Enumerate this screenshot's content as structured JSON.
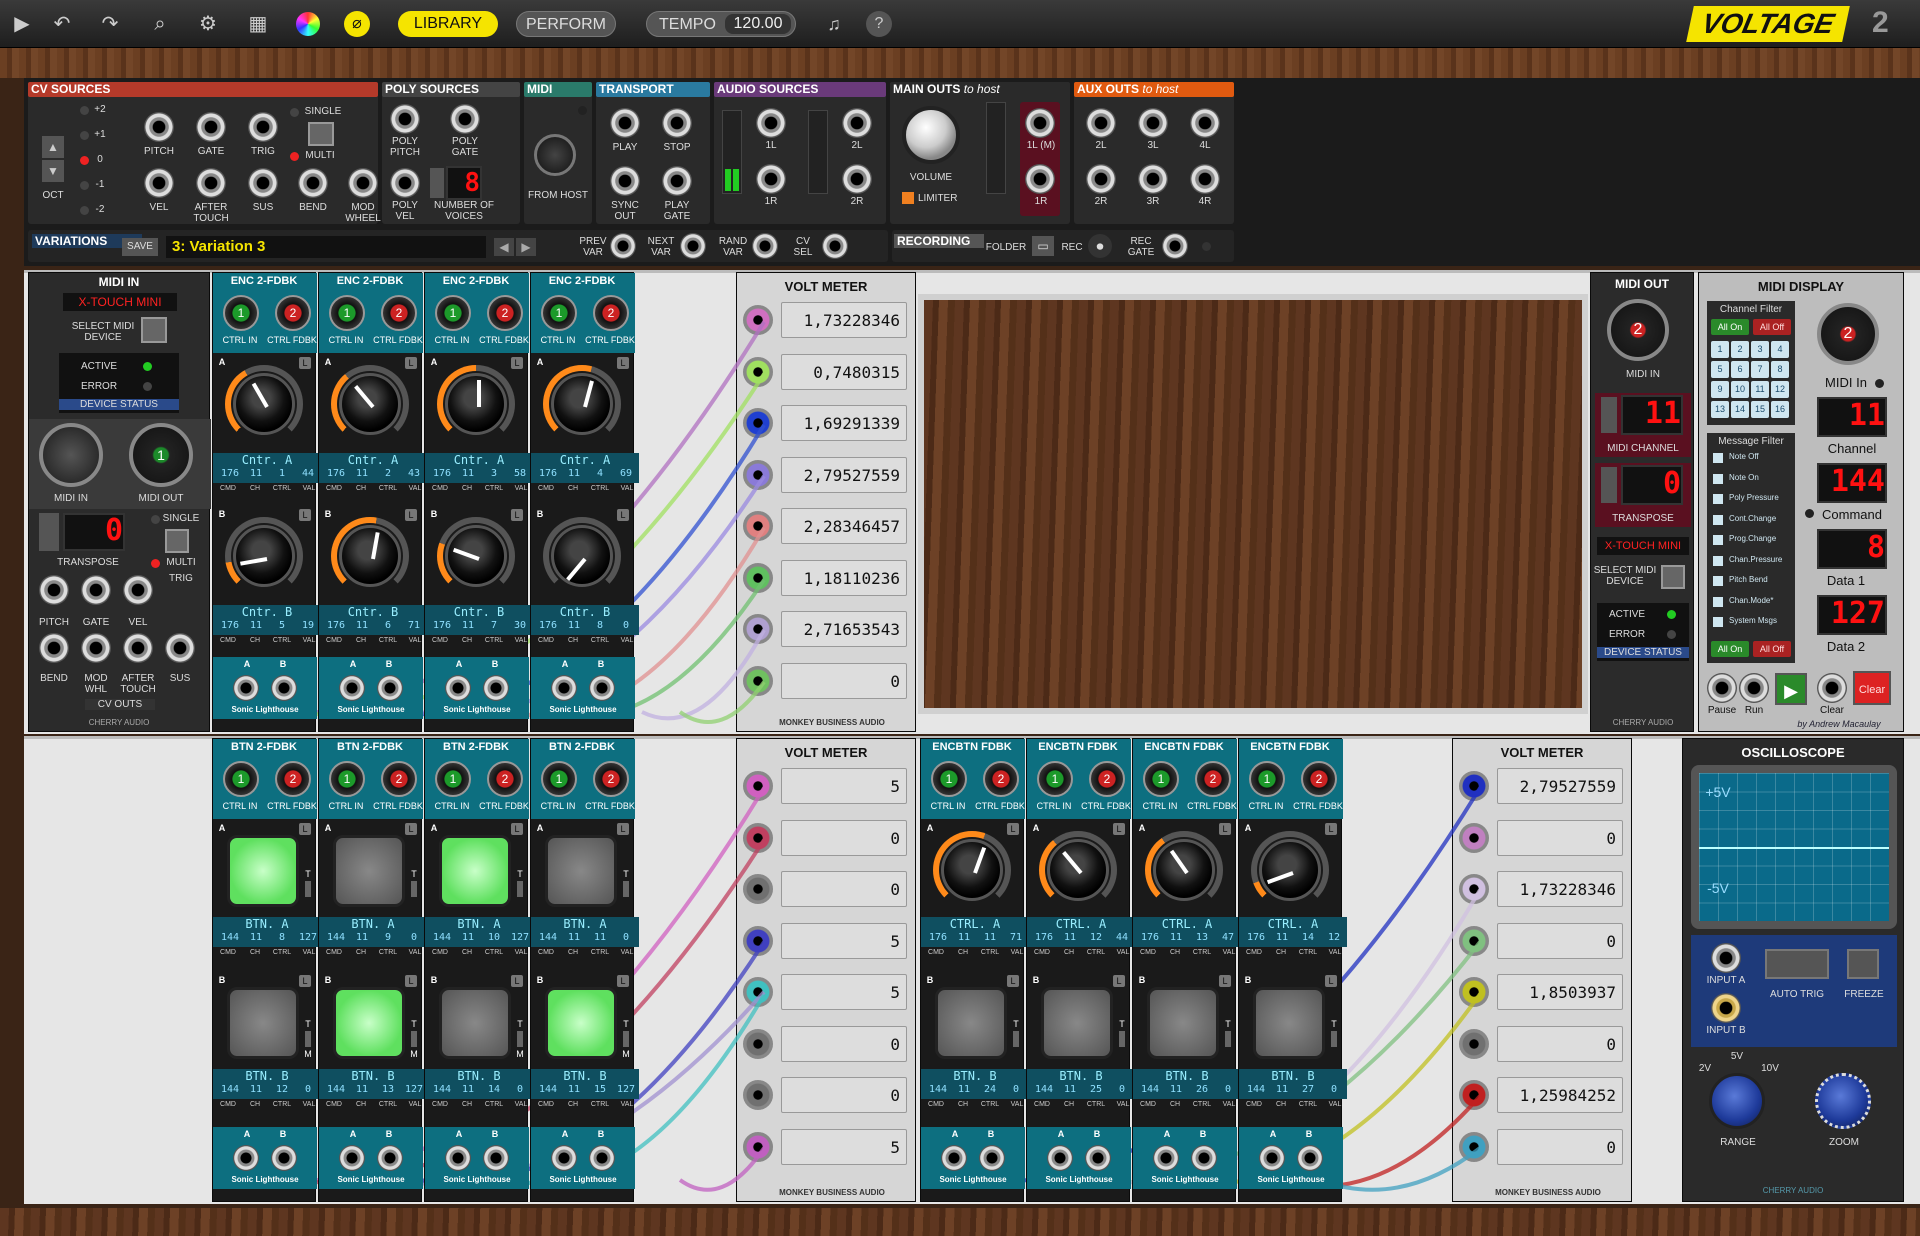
{
  "toolbar": {
    "library": "LIBRARY",
    "perform": "PERFORM",
    "tempo_label": "TEMPO",
    "tempo_value": "120.00",
    "help": "?",
    "brand": "VOLTAGE",
    "brand_version": "2"
  },
  "topstrip": {
    "cv_sources": "CV SOURCES",
    "cv_levels": [
      "+2",
      "+1",
      "0",
      "-1",
      "-2"
    ],
    "oct": "OCT",
    "single": "SINGLE",
    "multi": "MULTI",
    "cv_row1": [
      "PITCH",
      "GATE",
      "TRIG"
    ],
    "cv_row2": [
      "VEL",
      "AFTER TOUCH",
      "SUS",
      "BEND",
      "MOD WHEEL"
    ],
    "poly_sources": "POLY SOURCES",
    "poly_pitch": "POLY PITCH",
    "poly_gate": "POLY GATE",
    "poly_vel": "POLY VEL",
    "num_voices": "NUMBER OF VOICES",
    "num_voices_val": "8",
    "midi": "MIDI",
    "from_host": "FROM HOST",
    "transport": "TRANSPORT",
    "play": "PLAY",
    "stop": "STOP",
    "sync_out": "SYNC OUT",
    "play_gate": "PLAY GATE",
    "audio_sources": "AUDIO SOURCES",
    "a1l": "1L",
    "a2l": "2L",
    "a1r": "1R",
    "a2r": "2R",
    "main_outs": "MAIN OUTS",
    "main_outs_sub": "to host",
    "volume": "VOLUME",
    "limiter": "LIMITER",
    "m1l": "1L (M)",
    "m1r": "1R",
    "aux_outs": "AUX OUTS",
    "aux_outs_sub": "to host",
    "aux_top": [
      "2L",
      "3L",
      "4L"
    ],
    "aux_bot": [
      "2R",
      "3R",
      "4R"
    ],
    "variations": "VARIATIONS",
    "save": "SAVE",
    "variation_name": "3: Variation 3",
    "prev_var": "PREV VAR",
    "next_var": "NEXT VAR",
    "rand_var": "RAND VAR",
    "cv_sel": "CV SEL",
    "recording": "RECORDING",
    "folder": "FOLDER",
    "rec": "REC",
    "rec_gate": "REC GATE"
  },
  "midi_in": {
    "title": "MIDI IN",
    "device": "X-TOUCH MINI",
    "select": "SELECT MIDI DEVICE",
    "active": "ACTIVE",
    "error": "ERROR",
    "status": "DEVICE STATUS",
    "midi_in": "MIDI IN",
    "midi_out": "MIDI OUT",
    "midi_out_val": "1",
    "transpose": "TRANSPOSE",
    "transpose_val": "0",
    "single": "SINGLE",
    "multi": "MULTI",
    "trig": "TRIG",
    "row1": [
      "PITCH",
      "GATE",
      "VEL"
    ],
    "row2": [
      "BEND",
      "MOD WHL",
      "AFTER TOUCH",
      "SUS"
    ],
    "cv_outs": "CV OUTS",
    "brand": "CHERRY AUDIO"
  },
  "enc_modules": [
    {
      "title": "ENC 2-FDBK",
      "in": "1",
      "fb": "2",
      "a_label": "Cntr. A",
      "a_vals": [
        "176",
        "11",
        "1",
        "44"
      ],
      "b_label": "Cntr. B",
      "b_vals": [
        "176",
        "11",
        "5",
        "19"
      ],
      "a_angle": -30,
      "b_angle": -100
    },
    {
      "title": "ENC 2-FDBK",
      "in": "1",
      "fb": "2",
      "a_label": "Cntr. A",
      "a_vals": [
        "176",
        "11",
        "2",
        "43"
      ],
      "b_label": "Cntr. B",
      "b_vals": [
        "176",
        "11",
        "6",
        "71"
      ],
      "a_angle": -40,
      "b_angle": 10
    },
    {
      "title": "ENC 2-FDBK",
      "in": "1",
      "fb": "2",
      "a_label": "Cntr. A",
      "a_vals": [
        "176",
        "11",
        "3",
        "58"
      ],
      "b_label": "Cntr. B",
      "b_vals": [
        "176",
        "11",
        "7",
        "30"
      ],
      "a_angle": 0,
      "b_angle": -70
    },
    {
      "title": "ENC 2-FDBK",
      "in": "1",
      "fb": "2",
      "a_label": "Cntr. A",
      "a_vals": [
        "176",
        "11",
        "4",
        "69"
      ],
      "b_label": "Cntr. B",
      "b_vals": [
        "176",
        "11",
        "8",
        "0"
      ],
      "a_angle": 15,
      "b_angle": -140
    }
  ],
  "btn_modules": [
    {
      "title": "BTN 2-FDBK",
      "in": "1",
      "fb": "2",
      "a_on": true,
      "b_on": false,
      "a_vals": [
        "144",
        "11",
        "8",
        "127"
      ],
      "b_vals": [
        "144",
        "11",
        "12",
        "0"
      ]
    },
    {
      "title": "BTN 2-FDBK",
      "in": "1",
      "fb": "2",
      "a_on": false,
      "b_on": true,
      "a_vals": [
        "144",
        "11",
        "9",
        "0"
      ],
      "b_vals": [
        "144",
        "11",
        "13",
        "127"
      ]
    },
    {
      "title": "BTN 2-FDBK",
      "in": "1",
      "fb": "2",
      "a_on": true,
      "b_on": false,
      "a_vals": [
        "144",
        "11",
        "10",
        "127"
      ],
      "b_vals": [
        "144",
        "11",
        "14",
        "0"
      ]
    },
    {
      "title": "BTN 2-FDBK",
      "in": "1",
      "fb": "2",
      "a_on": false,
      "b_on": true,
      "a_vals": [
        "144",
        "11",
        "11",
        "0"
      ],
      "b_vals": [
        "144",
        "11",
        "15",
        "127"
      ]
    }
  ],
  "encbtn_modules": [
    {
      "title": "ENCBTN FDBK",
      "in": "1",
      "fb": "2",
      "a_vals": [
        "176",
        "11",
        "11",
        "71"
      ],
      "b_vals": [
        "144",
        "11",
        "24",
        "0"
      ],
      "angle": 20
    },
    {
      "title": "ENCBTN FDBK",
      "in": "1",
      "fb": "2",
      "a_vals": [
        "176",
        "11",
        "12",
        "44"
      ],
      "b_vals": [
        "144",
        "11",
        "25",
        "0"
      ],
      "angle": -40
    },
    {
      "title": "ENCBTN FDBK",
      "in": "1",
      "fb": "2",
      "a_vals": [
        "176",
        "11",
        "13",
        "47"
      ],
      "b_vals": [
        "144",
        "11",
        "26",
        "0"
      ],
      "angle": -35
    },
    {
      "title": "ENCBTN FDBK",
      "in": "1",
      "fb": "2",
      "a_vals": [
        "176",
        "11",
        "14",
        "12"
      ],
      "b_vals": [
        "144",
        "11",
        "27",
        "0"
      ],
      "angle": -110
    }
  ],
  "labels": {
    "ctrl_in": "CTRL IN",
    "ctrl_fdbk": "CTRL FDBK",
    "cmd": "CMD",
    "ch": "CH",
    "ctrl": "CTRL",
    "val": "VAL",
    "A": "A",
    "B": "B",
    "L": "L",
    "T": "T",
    "M": "M",
    "btn_a": "BTN. A",
    "btn_b": "BTN. B",
    "ctrl_a": "CTRL. A",
    "footer": "Sonic Lighthouse"
  },
  "volt_meter_1": {
    "title": "VOLT METER",
    "values": [
      "1,73228346",
      "0,7480315",
      "1,69291339",
      "2,79527559",
      "2,28346457",
      "1,18110236",
      "2,71653543",
      "0"
    ],
    "brand": "MONKEY BUSINESS AUDIO"
  },
  "volt_meter_2": {
    "title": "VOLT METER",
    "values": [
      "5",
      "0",
      "0",
      "5",
      "5",
      "0",
      "0",
      "5"
    ],
    "brand": "MONKEY BUSINESS AUDIO"
  },
  "volt_meter_3": {
    "title": "VOLT METER",
    "values": [
      "2,79527559",
      "0",
      "1,73228346",
      "0",
      "1,8503937",
      "0",
      "1,25984252",
      "0"
    ],
    "brand": "MONKEY BUSINESS AUDIO"
  },
  "midi_out": {
    "title": "MIDI OUT",
    "knob_val": "2",
    "midi_in": "MIDI IN",
    "channel_val": "11",
    "midi_channel": "MIDI CHANNEL",
    "transpose_val": "0",
    "transpose": "TRANSPOSE",
    "device": "X-TOUCH MINI",
    "select": "SELECT MIDI DEVICE",
    "active": "ACTIVE",
    "error": "ERROR",
    "status": "DEVICE STATUS",
    "brand": "CHERRY AUDIO"
  },
  "midi_display": {
    "title": "MIDI DISPLAY",
    "channel_filter": "Channel Filter",
    "all_on": "All On",
    "all_off": "All Off",
    "channels": [
      "1",
      "2",
      "3",
      "4",
      "5",
      "6",
      "7",
      "8",
      "9",
      "10",
      "11",
      "12",
      "13",
      "14",
      "15",
      "16"
    ],
    "message_filter": "Message Filter",
    "messages": [
      "Note Off",
      "Note On",
      "Poly Pressure",
      "Cont.Change",
      "Prog.Change",
      "Chan.Pressure",
      "Pitch Bend",
      "Chan.Mode*",
      "System Msgs"
    ],
    "midi_in_val": "2",
    "midi_in": "MIDI In",
    "channel_val": "11",
    "channel": "Channel",
    "command_val": "144",
    "command": "Command",
    "data1_val": "8",
    "data1": "Data 1",
    "data2_val": "127",
    "data2": "Data 2",
    "pause": "Pause",
    "run": "Run",
    "clear": "Clear",
    "clear_btn": "Clear",
    "author": "by Andrew Macaulay"
  },
  "oscilloscope": {
    "title": "OSCILLOSCOPE",
    "plus5": "+5V",
    "minus5": "-5V",
    "input_a": "INPUT A",
    "input_b": "INPUT B",
    "auto_trig": "AUTO TRIG",
    "freeze": "FREEZE",
    "range": "RANGE",
    "zoom": "ZOOM",
    "r2": "2V",
    "r5": "5V",
    "r10": "10V",
    "brand": "CHERRY AUDIO"
  },
  "colors": {
    "accent_yellow": "#f5e400",
    "teal": "#0d6f80",
    "pad_on": "#7dff7d",
    "display_red": "#ff1a1a"
  }
}
